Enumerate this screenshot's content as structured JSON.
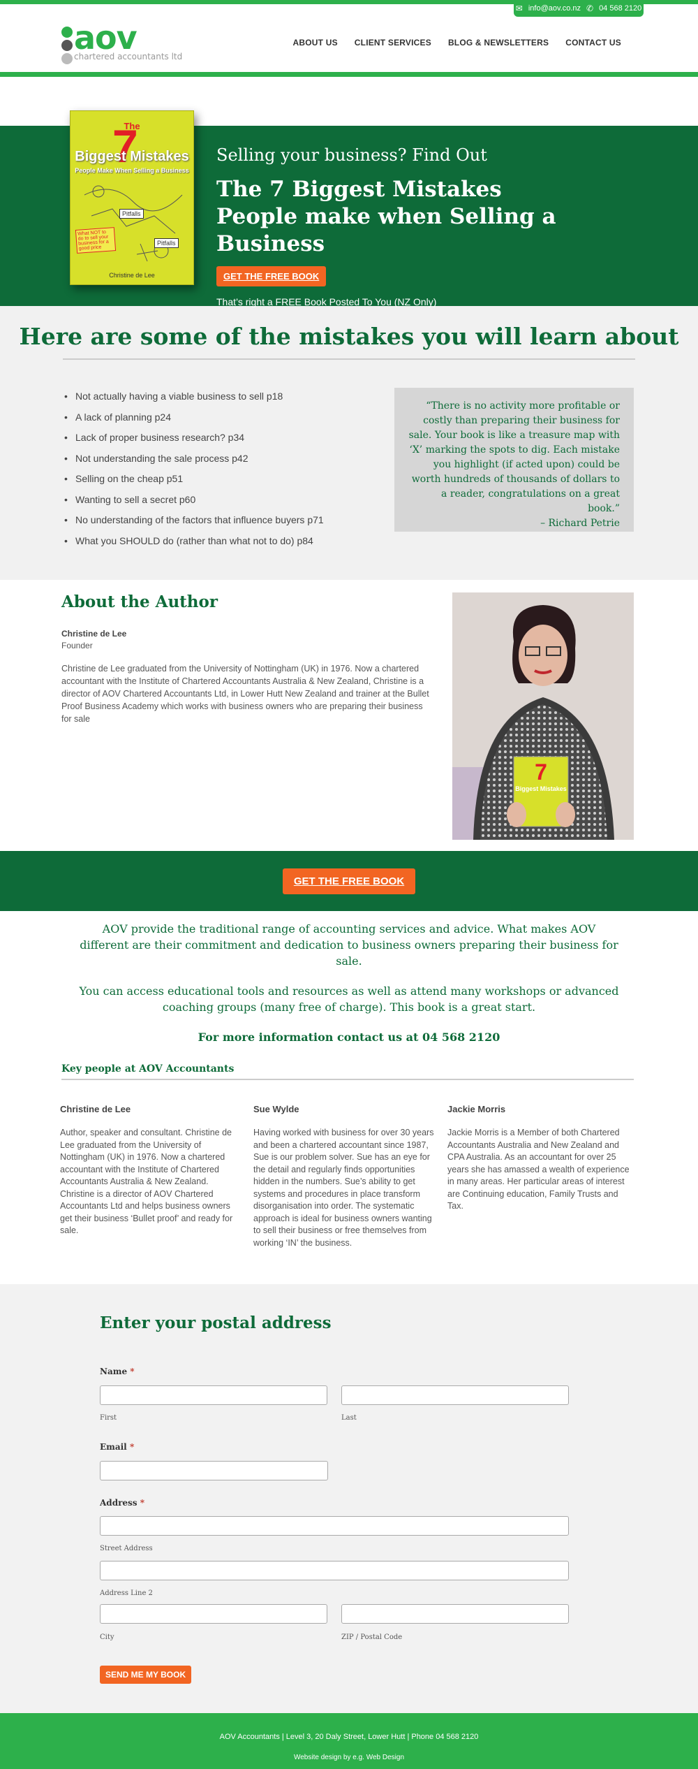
{
  "contact": {
    "email": "info@aov.co.nz",
    "phone": "04 568 2120",
    "email_icon": "mail-icon",
    "phone_icon": "phone-icon"
  },
  "logo": {
    "word": "aov",
    "sub": "chartered accountants ltd",
    "dot_colors": [
      "#2db04b",
      "#555555",
      "#bbbbbb"
    ]
  },
  "nav": [
    "ABOUT US",
    "CLIENT SERVICES",
    "BLOG & NEWSLETTERS",
    "CONTACT US"
  ],
  "hero": {
    "kicker": "Selling your business? Find Out",
    "title": "The 7 Biggest Mistakes People make when Selling a Business",
    "button": "GET THE FREE BOOK",
    "note": "That’s right a FREE Book Posted To You (NZ Only)",
    "book": {
      "the": "The",
      "seven": "7",
      "title": "Biggest Mistakes",
      "sub": "People Make When Selling a Business",
      "signs": [
        "Pitfalls",
        "Pitfalls"
      ],
      "note": "What NOT to do to sell your business for a good price",
      "author": "Christine de Lee"
    }
  },
  "mistakes": {
    "heading": "Here are some of the mistakes you will learn about",
    "items": [
      "Not actually having a viable business to sell p18",
      "A lack of planning p24",
      "Lack of proper business research? p34",
      "Not understanding the sale process p42",
      "Selling on the cheap p51",
      "Wanting to sell a secret p60",
      "No understanding of the factors that influence buyers p71",
      "What you SHOULD do (rather than what not to do) p84"
    ],
    "quote": "“There is no activity more profitable or costly than preparing their business for sale. Your book is like a treasure map with ‘X’ marking the spots to dig. Each mistake you highlight (if acted upon) could be worth hundreds of thousands of dollars to a reader, congratulations on a great book.”",
    "quote_author": "– Richard Petrie"
  },
  "author": {
    "heading": "About the Author",
    "name": "Christine de Lee",
    "role": "Founder",
    "bio": "Christine de Lee graduated from the University of Nottingham (UK) in 1976. Now a chartered accountant with the Institute of Chartered Accountants Australia & New Zealand, Christine is a director of AOV Chartered Accountants Ltd, in Lower Hutt New Zealand and trainer at the Bullet Proof Business Academy which works with business owners who are preparing their business for sale",
    "photo_book": {
      "seven": "7",
      "title": "Biggest Mistakes"
    }
  },
  "cta": {
    "button": "GET THE FREE BOOK"
  },
  "blurb": {
    "p1": "AOV provide the traditional range of accounting services and advice. What makes AOV different are their commitment and dedication to business owners preparing their business for sale.",
    "p2": "You can access educational tools and resources as well as attend many workshops or advanced coaching groups (many free of charge). This book is a great start.",
    "p3": "For more information contact us at 04 568 2120"
  },
  "keypeople": {
    "heading": "Key people at AOV Accountants",
    "people": [
      {
        "name": "Christine de Lee",
        "desc": "Author, speaker and consultant. Christine de Lee graduated from the University of Nottingham (UK) in 1976. Now a chartered accountant with the Institute of Chartered Accountants Australia & New Zealand. Christine is a director of AOV Chartered Accountants Ltd and helps business owners get their business ‘Bullet proof’ and ready for sale."
      },
      {
        "name": "Sue Wylde",
        "desc": "Having worked with business for over 30 years and been a chartered accountant since 1987, Sue is our problem solver. Sue has an eye for the detail and regularly finds opportunities hidden in the numbers. Sue’s ability to get systems and procedures in place transform disorganisation into order. The systematic approach is ideal for business owners wanting to sell their business or free themselves from working ‘IN’ the business."
      },
      {
        "name": "Jackie Morris",
        "desc": "Jackie Morris is a Member of both Chartered Accountants Australia and New Zealand and CPA Australia. As an accountant for over 25 years she has amassed a wealth of experience in many areas. Her particular areas of interest are Continuing education, Family Trusts and Tax."
      }
    ]
  },
  "form": {
    "heading": "Enter your postal address",
    "name_label": "Name",
    "first": "First",
    "last": "Last",
    "email_label": "Email",
    "address_label": "Address",
    "street": "Street Address",
    "line2": "Address Line 2",
    "city": "City",
    "zip": "ZIP / Postal Code",
    "required_mark": "*",
    "button": "SEND ME MY BOOK"
  },
  "footer": {
    "line": "AOV Accountants | Level 3, 20 Daly Street, Lower Hutt | Phone 04 568 2120",
    "credit": "Website design by e.g. Web Design"
  },
  "colors": {
    "brand_green": "#2db04b",
    "dark_green": "#0e6b39",
    "orange": "#f26522",
    "light_grey": "#f1f1f1"
  }
}
